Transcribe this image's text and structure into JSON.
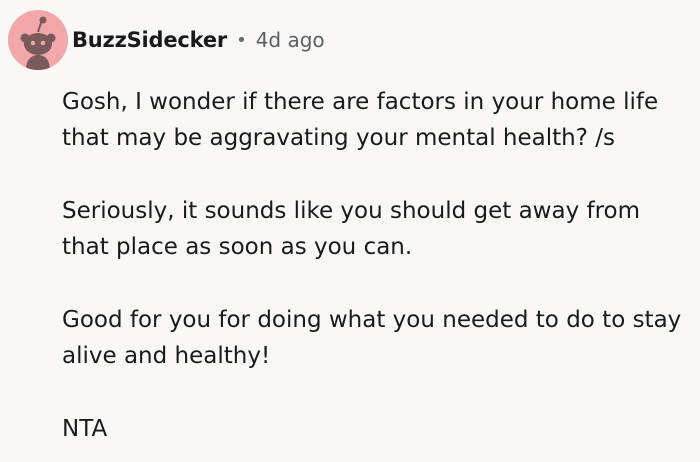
{
  "comment": {
    "author": "BuzzSidecker",
    "separator": "•",
    "timestamp": "4d ago",
    "avatar_icon": "reddit-snoo-avatar-icon",
    "avatar_color": "#f2a8a8",
    "paragraphs": [
      "Gosh, I wonder if there are factors in your home life that may be aggravating your mental health?  /s",
      "Seriously, it sounds like you should get away from that place as soon as you can.",
      "Good for you for doing what you needed to do to stay alive and healthy!",
      "NTA"
    ]
  }
}
